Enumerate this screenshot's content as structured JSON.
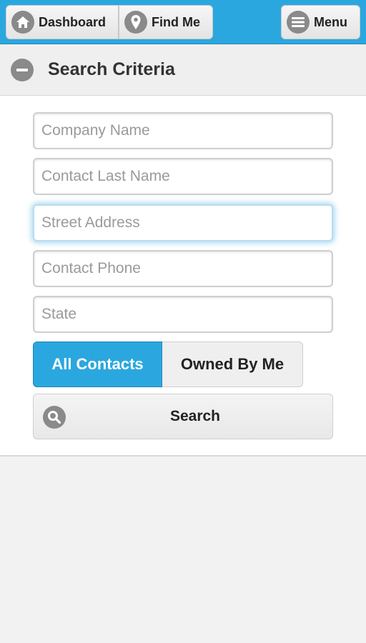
{
  "toolbar": {
    "dashboard_label": "Dashboard",
    "dashboard_icon": "home-icon",
    "findme_label": "Find Me",
    "findme_icon": "map-pin-icon",
    "menu_label": "Menu",
    "menu_icon": "menu-icon"
  },
  "section": {
    "title": "Search Criteria",
    "toggle_icon": "collapse-minus-icon"
  },
  "form": {
    "company_name": {
      "placeholder": "Company Name",
      "value": ""
    },
    "contact_last_name": {
      "placeholder": "Contact Last Name",
      "value": ""
    },
    "street_address": {
      "placeholder": "Street Address",
      "value": ""
    },
    "contact_phone": {
      "placeholder": "Contact Phone",
      "value": ""
    },
    "state": {
      "placeholder": "State",
      "value": ""
    }
  },
  "filter": {
    "all_contacts_label": "All Contacts",
    "owned_by_me_label": "Owned By Me",
    "selected": "All Contacts"
  },
  "search_button": {
    "label": "Search",
    "icon": "search-icon"
  },
  "colors": {
    "accent": "#2ba7df",
    "icon_gray": "#8a8a8a"
  }
}
